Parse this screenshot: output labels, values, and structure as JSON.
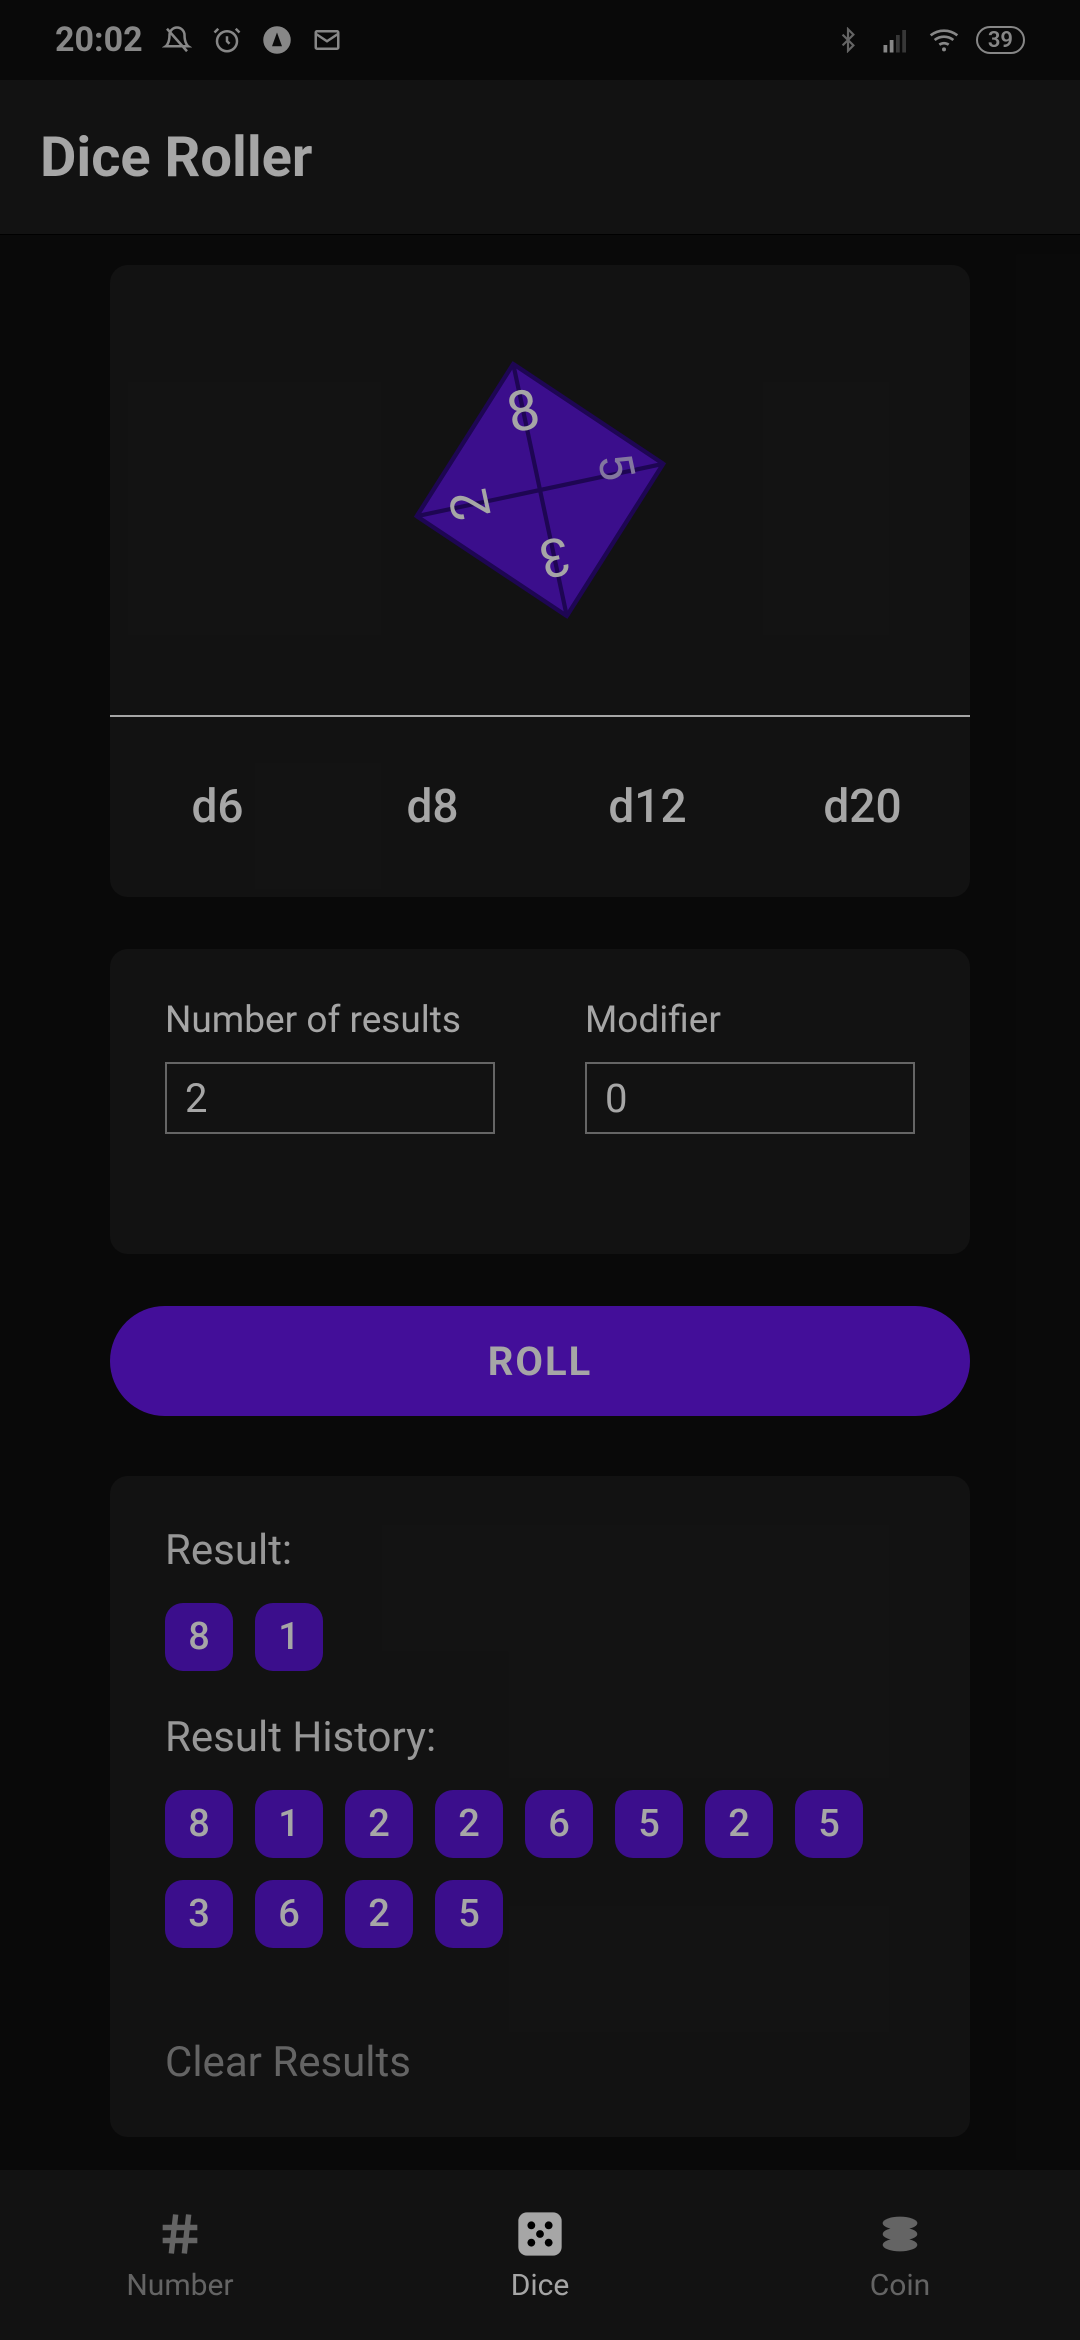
{
  "status": {
    "time": "20:02",
    "battery": "39"
  },
  "app": {
    "title": "Dice Roller"
  },
  "dice": {
    "tabs": [
      "d6",
      "d8",
      "d12",
      "d20"
    ],
    "selected": "d8",
    "face_numbers": [
      "8",
      "5",
      "2",
      "3"
    ]
  },
  "inputs": {
    "number_label": "Number of results",
    "number_value": "2",
    "modifier_label": "Modifier",
    "modifier_value": "0"
  },
  "roll_button": "ROLL",
  "results": {
    "label": "Result:",
    "values": [
      "8",
      "1"
    ],
    "history_label": "Result History:",
    "history": [
      "8",
      "1",
      "2",
      "2",
      "6",
      "5",
      "2",
      "5",
      "3",
      "6",
      "2",
      "5"
    ],
    "clear_label": "Clear Results"
  },
  "nav": {
    "items": [
      {
        "id": "number",
        "label": "Number"
      },
      {
        "id": "dice",
        "label": "Dice"
      },
      {
        "id": "coin",
        "label": "Coin"
      }
    ],
    "active": "dice"
  },
  "colors": {
    "accent": "#6716ec",
    "pill": "#5b16d8",
    "card": "#1d1d1d",
    "bg": "#0f0f0f"
  }
}
